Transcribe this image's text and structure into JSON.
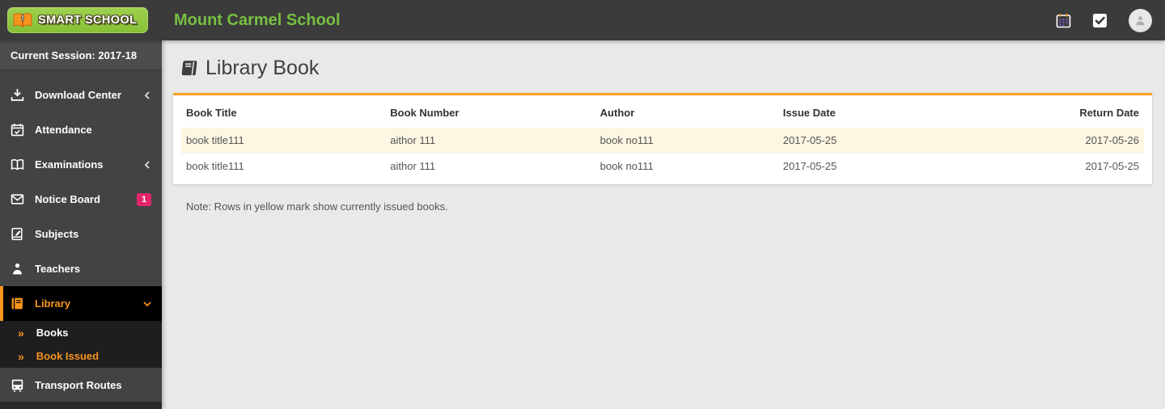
{
  "topbar": {
    "logo_text": "SMART SCHOOL",
    "school_name": "Mount Carmel School",
    "icons": [
      "calendar-icon",
      "tasks-icon",
      "avatar"
    ]
  },
  "sidebar": {
    "session_label": "Current Session: 2017-18",
    "items": [
      {
        "label": "Download Center",
        "icon": "download-icon",
        "chevron": "left"
      },
      {
        "label": "Attendance",
        "icon": "calendar-check-icon"
      },
      {
        "label": "Examinations",
        "icon": "open-book-icon",
        "chevron": "left"
      },
      {
        "label": "Notice Board",
        "icon": "envelope-icon",
        "badge": "1"
      },
      {
        "label": "Subjects",
        "icon": "book-pencil-icon"
      },
      {
        "label": "Teachers",
        "icon": "teacher-icon"
      },
      {
        "label": "Library",
        "icon": "book-icon",
        "chevron": "down",
        "active": true,
        "submenu": [
          {
            "label": "Books",
            "active": false
          },
          {
            "label": "Book Issued",
            "active": true
          }
        ]
      },
      {
        "label": "Transport Routes",
        "icon": "bus-icon"
      }
    ]
  },
  "main": {
    "title": "Library Book",
    "table": {
      "columns": [
        "Book Title",
        "Book Number",
        "Author",
        "Issue Date",
        "Return Date"
      ],
      "rows": [
        {
          "highlighted": true,
          "cells": [
            "book title111",
            "aithor 111",
            "book no111",
            "2017-05-25",
            "2017-05-26"
          ]
        },
        {
          "highlighted": false,
          "cells": [
            "book title111",
            "aithor 111",
            "book no111",
            "2017-05-25",
            "2017-05-25"
          ]
        }
      ]
    },
    "note": "Note: Rows in yellow mark show currently issued books."
  },
  "colors": {
    "topbar_bg": "#3b3b3b",
    "sidebar_bg": "#434343",
    "accent_orange": "#f7941e",
    "brand_green": "#8dc63f",
    "school_name_green": "#77c043",
    "badge_pink": "#e2256b",
    "highlight_row": "#fdf6e2",
    "card_top_border": "#f5a326"
  }
}
